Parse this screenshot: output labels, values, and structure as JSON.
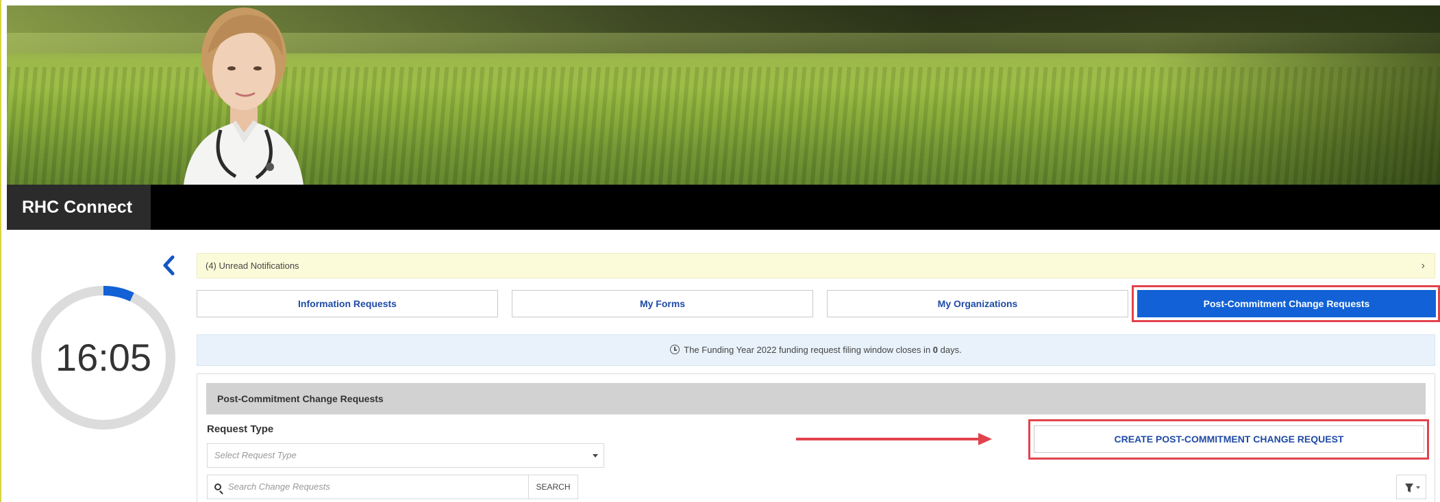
{
  "app": {
    "title": "RHC Connect"
  },
  "timer": {
    "time": "16:05",
    "progress_fraction": 0.07
  },
  "notifications": {
    "text": "(4) Unread Notifications"
  },
  "tabs": [
    {
      "label": "Information Requests",
      "active": false
    },
    {
      "label": "My Forms",
      "active": false
    },
    {
      "label": "My Organizations",
      "active": false
    },
    {
      "label": "Post-Commitment Change Requests",
      "active": true
    }
  ],
  "info": {
    "prefix": "The Funding Year 2022 funding request filing window closes in",
    "days": "0",
    "suffix": "days."
  },
  "panel": {
    "title": "Post-Commitment Change Requests",
    "request_type_label": "Request Type",
    "request_type_placeholder": "Select Request Type",
    "search_placeholder": "Search Change Requests",
    "search_button": "SEARCH",
    "create_button": "CREATE POST-COMMITMENT CHANGE REQUEST"
  },
  "colors": {
    "accent": "#1261d6",
    "highlight": "#e2424c",
    "notif_bg": "#fcfbd9",
    "info_bg": "#e9f2fb"
  },
  "icons": [
    "chevron-left-icon",
    "chevron-right-icon",
    "clock-icon",
    "search-icon",
    "filter-icon",
    "caret-down-icon"
  ]
}
